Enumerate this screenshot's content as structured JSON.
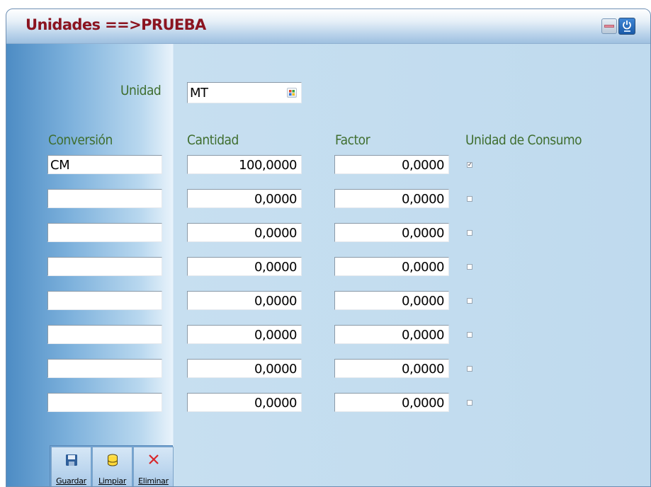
{
  "window": {
    "title": "Unidades ==>PRUEBA"
  },
  "unidad": {
    "label": "Unidad",
    "value": "MT"
  },
  "headers": {
    "conversion": "Conversión",
    "cantidad": "Cantidad",
    "factor": "Factor",
    "consumo": "Unidad de Consumo"
  },
  "rows": [
    {
      "conversion": "CM",
      "cantidad": "100,0000",
      "factor": "0,0000",
      "consumo": true
    },
    {
      "conversion": "",
      "cantidad": "0,0000",
      "factor": "0,0000",
      "consumo": false
    },
    {
      "conversion": "",
      "cantidad": "0,0000",
      "factor": "0,0000",
      "consumo": false
    },
    {
      "conversion": "",
      "cantidad": "0,0000",
      "factor": "0,0000",
      "consumo": false
    },
    {
      "conversion": "",
      "cantidad": "0,0000",
      "factor": "0,0000",
      "consumo": false
    },
    {
      "conversion": "",
      "cantidad": "0,0000",
      "factor": "0,0000",
      "consumo": false
    },
    {
      "conversion": "",
      "cantidad": "0,0000",
      "factor": "0,0000",
      "consumo": false
    },
    {
      "conversion": "",
      "cantidad": "0,0000",
      "factor": "0,0000",
      "consumo": false
    }
  ],
  "toolbar": {
    "guardar": "Guardar",
    "limpiar": "Limpiar",
    "eliminar": "Eliminar"
  },
  "icons": {
    "minimize": "minimize-icon",
    "power": "power-icon",
    "lookup": "lookup-icon",
    "save": "save-icon",
    "clear": "database-icon",
    "delete": "close-icon"
  }
}
